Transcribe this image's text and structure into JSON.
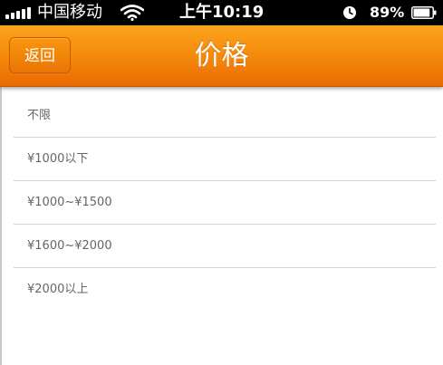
{
  "status_bar": {
    "carrier": "中国移动",
    "time": "上午10:19",
    "battery": "89%",
    "signal_icon": "signal-bars-icon",
    "wifi_icon": "wifi-icon",
    "alarm_icon": "alarm-clock-icon",
    "battery_icon": "battery-icon",
    "battery_level": 0.89
  },
  "nav": {
    "back_label": "返回",
    "title": "价格"
  },
  "price_options": [
    "不限",
    "¥1000以下",
    "¥1000~¥1500",
    "¥1600~¥2000",
    "¥2000以上"
  ],
  "colors": {
    "nav_orange": "#f58a0c",
    "status_bar": "#000000",
    "item_text": "#666666",
    "divider": "#d5d5d5"
  }
}
